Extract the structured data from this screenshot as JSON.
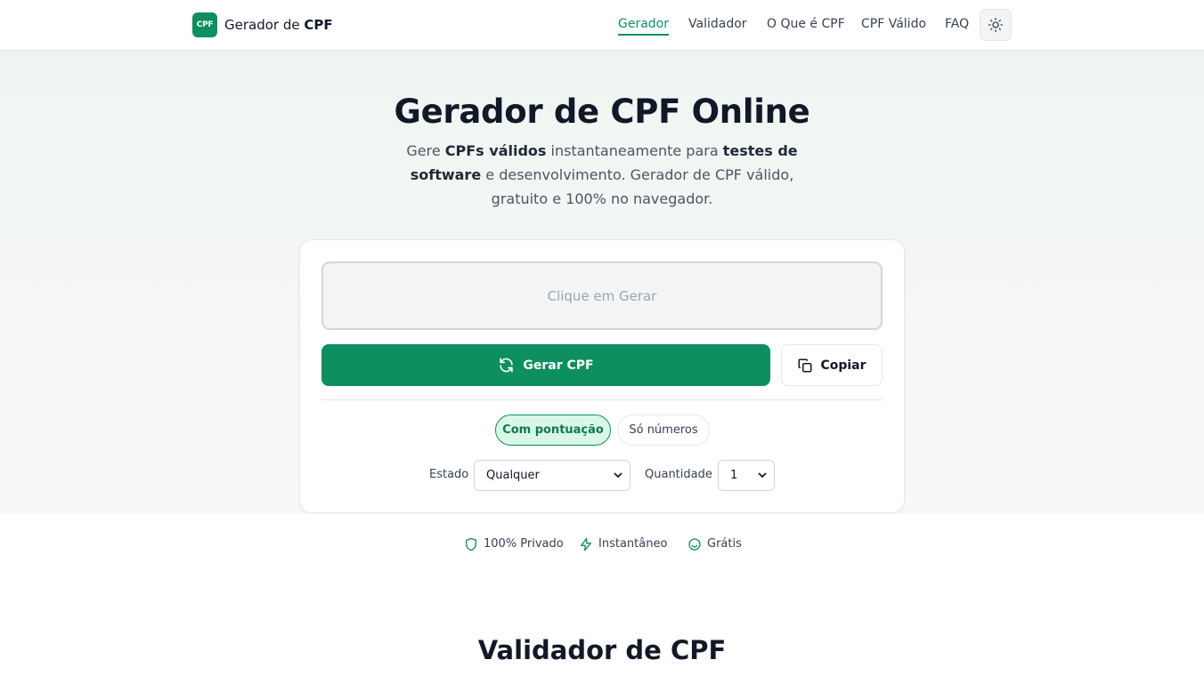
{
  "header": {
    "logo_badge": "CPF",
    "logo_prefix": "Gerador de ",
    "logo_bold": "CPF",
    "nav": [
      {
        "label": "Gerador",
        "active": true
      },
      {
        "label": "Validador",
        "active": false
      },
      {
        "label": "O Que é CPF",
        "active": false
      },
      {
        "label": "CPF Válido",
        "active": false
      },
      {
        "label": "FAQ",
        "active": false
      }
    ],
    "theme_icon": "sun-icon"
  },
  "hero": {
    "title": "Gerador de CPF Online",
    "subtitle_parts": [
      "Gere ",
      "CPFs válidos",
      " instantaneamente para ",
      "testes de software",
      " e desenvolvimento. Gerador de CPF válido, gratuito e 100% no navegador."
    ]
  },
  "generator": {
    "output_placeholder": "Clique em Gerar",
    "generate_label": "Gerar CPF",
    "copy_label": "Copiar",
    "format_options": [
      "Com pontuação",
      "Só números"
    ],
    "selected_format": "Com pontuação",
    "estado_label": "Estado",
    "estado_value": "Qualquer",
    "quantidade_label": "Quantidade",
    "quantidade_value": "1"
  },
  "features": [
    {
      "icon": "shield-icon",
      "label": "100% Privado"
    },
    {
      "icon": "lightning-icon",
      "label": "Instantâneo"
    },
    {
      "icon": "smile-icon",
      "label": "Grátis"
    }
  ],
  "next_section_title": "Validador de CPF",
  "colors": {
    "brand": "#0d8f5f",
    "pill_active_bg": "#d9f7e7",
    "text": "#111827"
  }
}
